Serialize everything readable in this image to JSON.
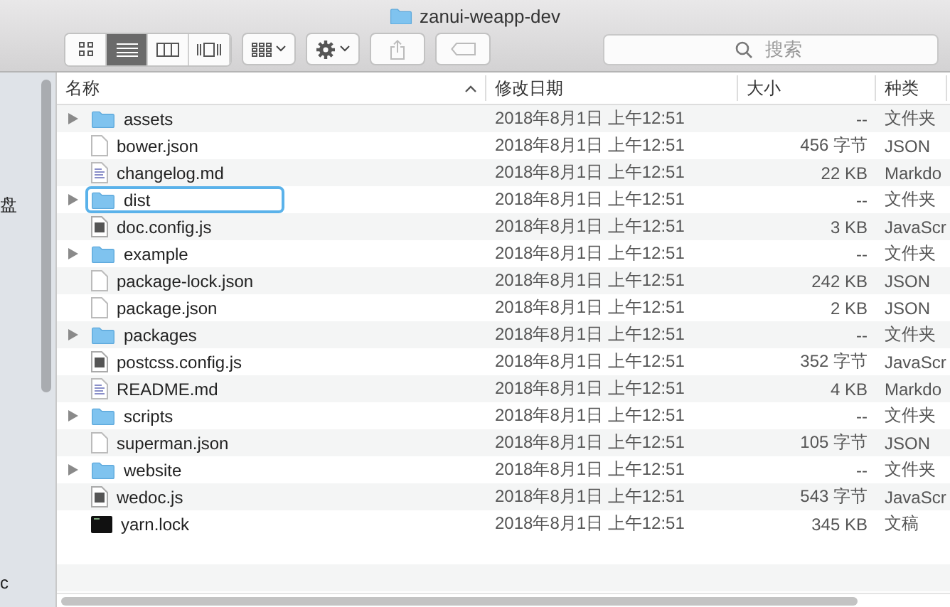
{
  "window": {
    "title": "zanui-weapp-dev"
  },
  "view_modes": [
    {
      "kind": "icons",
      "selected": false
    },
    {
      "kind": "list",
      "selected": true
    },
    {
      "kind": "columns",
      "selected": false
    },
    {
      "kind": "gallery",
      "selected": false
    }
  ],
  "search": {
    "placeholder": "搜索"
  },
  "sidebar": {
    "items": [
      "盘",
      "c"
    ]
  },
  "columns": [
    {
      "label": "名称",
      "sorted": true
    },
    {
      "label": "修改日期",
      "sorted": false
    },
    {
      "label": "大小",
      "sorted": false
    },
    {
      "label": "种类",
      "sorted": false
    }
  ],
  "rows": [
    {
      "name": "assets",
      "kind": "folder",
      "date": "2018年8月1日 上午12:51",
      "size": "--",
      "type": "文件夹",
      "highlighted": false
    },
    {
      "name": "bower.json",
      "kind": "file",
      "date": "2018年8月1日 上午12:51",
      "size": "456 字节",
      "type": "JSON",
      "highlighted": false
    },
    {
      "name": "changelog.md",
      "kind": "text",
      "date": "2018年8月1日 上午12:51",
      "size": "22 KB",
      "type": "Markdo",
      "highlighted": false
    },
    {
      "name": "dist",
      "kind": "folder",
      "date": "2018年8月1日 上午12:51",
      "size": "--",
      "type": "文件夹",
      "highlighted": true
    },
    {
      "name": "doc.config.js",
      "kind": "script",
      "date": "2018年8月1日 上午12:51",
      "size": "3 KB",
      "type": "JavaScr",
      "highlighted": false
    },
    {
      "name": "example",
      "kind": "folder",
      "date": "2018年8月1日 上午12:51",
      "size": "--",
      "type": "文件夹",
      "highlighted": false
    },
    {
      "name": "package-lock.json",
      "kind": "file",
      "date": "2018年8月1日 上午12:51",
      "size": "242 KB",
      "type": "JSON",
      "highlighted": false
    },
    {
      "name": "package.json",
      "kind": "file",
      "date": "2018年8月1日 上午12:51",
      "size": "2 KB",
      "type": "JSON",
      "highlighted": false
    },
    {
      "name": "packages",
      "kind": "folder",
      "date": "2018年8月1日 上午12:51",
      "size": "--",
      "type": "文件夹",
      "highlighted": false
    },
    {
      "name": "postcss.config.js",
      "kind": "script",
      "date": "2018年8月1日 上午12:51",
      "size": "352 字节",
      "type": "JavaScr",
      "highlighted": false
    },
    {
      "name": "README.md",
      "kind": "text",
      "date": "2018年8月1日 上午12:51",
      "size": "4 KB",
      "type": "Markdo",
      "highlighted": false
    },
    {
      "name": "scripts",
      "kind": "folder",
      "date": "2018年8月1日 上午12:51",
      "size": "--",
      "type": "文件夹",
      "highlighted": false
    },
    {
      "name": "superman.json",
      "kind": "file",
      "date": "2018年8月1日 上午12:51",
      "size": "105 字节",
      "type": "JSON",
      "highlighted": false
    },
    {
      "name": "website",
      "kind": "folder",
      "date": "2018年8月1日 上午12:51",
      "size": "--",
      "type": "文件夹",
      "highlighted": false
    },
    {
      "name": "wedoc.js",
      "kind": "script",
      "date": "2018年8月1日 上午12:51",
      "size": "543 字节",
      "type": "JavaScr",
      "highlighted": false
    },
    {
      "name": "yarn.lock",
      "kind": "exec",
      "date": "2018年8月1日 上午12:51",
      "size": "345 KB",
      "type": "文稿",
      "highlighted": false
    }
  ]
}
